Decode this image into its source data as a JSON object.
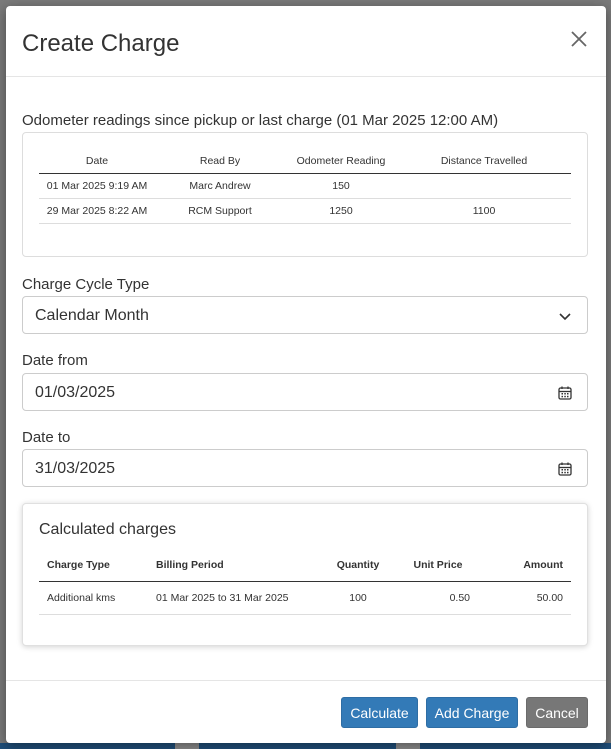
{
  "modal": {
    "title": "Create Charge",
    "odometer": {
      "label": "Odometer readings since pickup or last charge (01 Mar 2025 12:00 AM)",
      "columns": [
        "Date",
        "Read By",
        "Odometer Reading",
        "Distance Travelled"
      ],
      "rows": [
        [
          "01 Mar 2025 9:19 AM",
          "Marc Andrew",
          "150",
          ""
        ],
        [
          "29 Mar 2025 8:22 AM",
          "RCM Support",
          "1250",
          "1100"
        ]
      ]
    },
    "charge_cycle": {
      "label": "Charge Cycle Type",
      "value": "Calendar Month"
    },
    "date_from": {
      "label": "Date from",
      "value": "01/03/2025"
    },
    "date_to": {
      "label": "Date to",
      "value": "31/03/2025"
    },
    "calculated": {
      "title": "Calculated charges",
      "columns": [
        "Charge Type",
        "Billing Period",
        "Quantity",
        "Unit Price",
        "Amount"
      ],
      "rows": [
        [
          "Additional kms",
          "01 Mar 2025 to 31 Mar 2025",
          "100",
          "0.50",
          "50.00"
        ]
      ]
    },
    "buttons": {
      "calculate": "Calculate",
      "add_charge": "Add Charge",
      "cancel": "Cancel"
    }
  },
  "colors": {
    "primary": "#337ab7",
    "secondary": "#777777"
  }
}
